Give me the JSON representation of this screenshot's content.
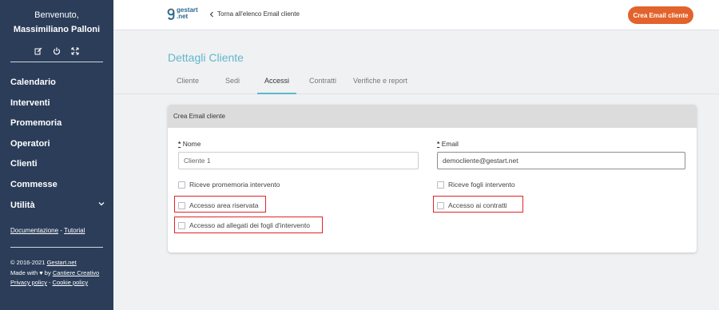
{
  "sidebar": {
    "welcome": "Benvenuto,",
    "user_name": "Massimiliano Palloni",
    "actions": [
      {
        "icon": "edit-icon"
      },
      {
        "icon": "power-icon"
      },
      {
        "icon": "fullscreen-icon"
      }
    ],
    "nav": [
      {
        "label": "Calendario"
      },
      {
        "label": "Interventi"
      },
      {
        "label": "Promemoria"
      },
      {
        "label": "Operatori"
      },
      {
        "label": "Clienti"
      },
      {
        "label": "Commesse"
      },
      {
        "label": "Utilità",
        "has_submenu": true
      }
    ],
    "links": {
      "documentation": "Documentazione",
      "separator": " - ",
      "tutorial": "Tutorial"
    },
    "footer": {
      "copyright_prefix": "© 2016-2021 ",
      "copyright_link": "Gestart.net",
      "made_with_prefix": "Made with ♥ by ",
      "made_with_link": "Cantiere Creativo",
      "privacy": "Privacy policy",
      "sep": " - ",
      "cookie": "Cookie policy"
    },
    "bg_color": "#2b3d59"
  },
  "topbar": {
    "logo_line1": "gestart",
    "logo_line2": ".net",
    "back_label": "Torna all'elenco Email cliente",
    "create_button": "Crea Email cliente",
    "accent_color": "#e2632b"
  },
  "main": {
    "title": "Dettagli Cliente",
    "tabs": [
      {
        "label": "Cliente",
        "active": false
      },
      {
        "label": "Sedi",
        "active": false
      },
      {
        "label": "Accessi",
        "active": true
      },
      {
        "label": "Contratti",
        "active": false
      },
      {
        "label": "Verifiche e report",
        "active": false
      }
    ],
    "form": {
      "header": "Crea Email cliente",
      "name_required_mark": "*",
      "name_label": "Nome",
      "name_value": "Cliente 1",
      "email_required_mark": "*",
      "email_label": "Email",
      "email_value": "democliente@gestart.net",
      "checkboxes": {
        "promemoria": {
          "label": "Riceve promemoria intervento",
          "checked": false
        },
        "fogli": {
          "label": "Riceve fogli intervento",
          "checked": false
        },
        "area_riservata": {
          "label": "Accesso area riservata",
          "checked": false,
          "highlighted": true
        },
        "contratti": {
          "label": "Accesso ai contratti",
          "checked": false,
          "highlighted": true
        },
        "allegati": {
          "label": "Accesso ad allegati dei fogli d'intervento",
          "checked": false,
          "highlighted": true
        }
      }
    },
    "title_color": "#5fb8cc",
    "highlight_color": "#e0242a"
  }
}
